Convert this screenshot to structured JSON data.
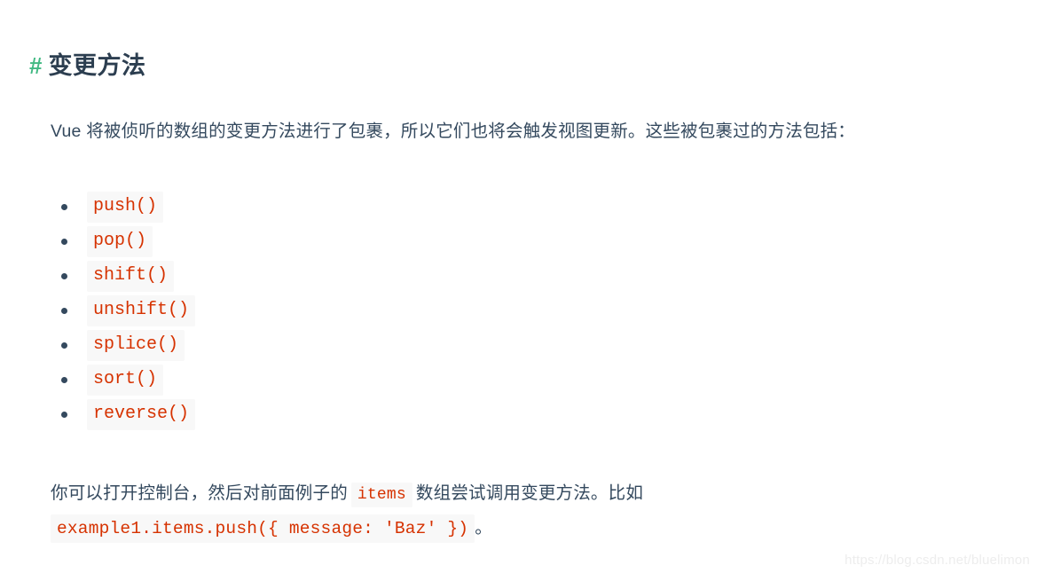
{
  "heading": {
    "anchor": "#",
    "text": "变更方法",
    "anchor_color": "#42b983",
    "text_color": "#2c3e50"
  },
  "intro_paragraph": {
    "text": "Vue 将被侦听的数组的变更方法进行了包裹，所以它们也将会触发视图更新。这些被包裹过的方法包括："
  },
  "methods": [
    {
      "label": "push()"
    },
    {
      "label": "pop()"
    },
    {
      "label": "shift()"
    },
    {
      "label": "unshift()"
    },
    {
      "label": "splice()"
    },
    {
      "label": "sort()"
    },
    {
      "label": "reverse()"
    }
  ],
  "outro_paragraph": {
    "part1": "你可以打开控制台，然后对前面例子的",
    "code_items": "items",
    "part2": "数组尝试调用变更方法。比如",
    "code_example": "example1.items.push({ message: 'Baz' })",
    "part3": "。"
  },
  "watermark": {
    "text": "https://blog.csdn.net/bluelimon"
  },
  "colors": {
    "background": "#ffffff",
    "body_text": "#34495e",
    "heading_text": "#2c3e50",
    "accent_green": "#42b983",
    "code_text": "#d63200",
    "code_background": "#f8f8f8",
    "bullet": "#34495e",
    "watermark": "#ededed"
  }
}
